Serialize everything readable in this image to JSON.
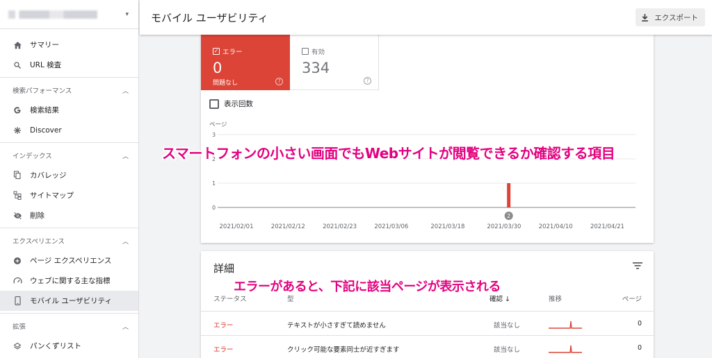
{
  "sidebar": {
    "property_caret": "▾",
    "top_items": [
      {
        "label": "サマリー",
        "icon": "home-icon"
      },
      {
        "label": "URL 検査",
        "icon": "search-icon"
      }
    ],
    "sections": [
      {
        "title": "検索パフォーマンス",
        "items": [
          {
            "label": "検索結果",
            "icon": "google-g-icon"
          },
          {
            "label": "Discover",
            "icon": "asterisk-icon"
          }
        ]
      },
      {
        "title": "インデックス",
        "items": [
          {
            "label": "カバレッジ",
            "icon": "copy-icon"
          },
          {
            "label": "サイトマップ",
            "icon": "sitemap-icon"
          },
          {
            "label": "削除",
            "icon": "eye-off-icon"
          }
        ]
      },
      {
        "title": "エクスペリエンス",
        "items": [
          {
            "label": "ページ エクスペリエンス",
            "icon": "add-circle-icon"
          },
          {
            "label": "ウェブに関する主な指標",
            "icon": "speed-icon"
          },
          {
            "label": "モバイル ユーザビリティ",
            "icon": "smartphone-icon",
            "active": true
          }
        ]
      },
      {
        "title": "拡張",
        "items": [
          {
            "label": "パンくずリスト",
            "icon": "layers-icon"
          }
        ]
      }
    ]
  },
  "header": {
    "title": "モバイル ユーザビリティ",
    "export_label": "エクスポート"
  },
  "summary": {
    "error": {
      "label": "エラー",
      "value": "0",
      "sub": "問題なし",
      "checked": true
    },
    "valid": {
      "label": "有効",
      "value": "334",
      "checked": false
    },
    "impressions_label": "表示回数"
  },
  "chart_data": {
    "type": "bar",
    "ylabel": "ページ",
    "ylim": [
      0,
      3
    ],
    "y_ticks": [
      "0",
      "1",
      "2",
      "3"
    ],
    "x_tick_labels": [
      "2021/02/01",
      "2021/02/12",
      "2021/02/23",
      "2021/03/06",
      "2021/03/18",
      "2021/03/30",
      "2021/04/10",
      "2021/04/21"
    ],
    "x_range": [
      "2021/01/28",
      "2021/04/27"
    ],
    "series": [
      {
        "color": "#db4437",
        "points": [
          {
            "x": "2021/03/31",
            "y": 1
          }
        ]
      }
    ],
    "annotations": [
      {
        "x": "2021/03/31",
        "label": "2"
      }
    ]
  },
  "details": {
    "title": "詳細",
    "columns": {
      "status": "ステータス",
      "type": "型",
      "confirm": "確認",
      "sort_arrow": "↓",
      "trend": "推移",
      "pages": "ページ"
    },
    "rows": [
      {
        "status": "エラー",
        "type": "テキストが小さすぎて読めません",
        "confirm": "該当なし",
        "pages": "0"
      },
      {
        "status": "エラー",
        "type": "クリック可能な要素同士が近すぎます",
        "confirm": "該当なし",
        "pages": "0"
      }
    ]
  },
  "callouts": {
    "top": "スマートフォンの小さい画面でもWebサイトが閲覧できるか確認する項目",
    "bottom": "エラーがあると、下記に該当ページが表示される"
  },
  "colors": {
    "error": "#db4437",
    "callout": "#e3007f",
    "accent_status": "#d93025"
  }
}
